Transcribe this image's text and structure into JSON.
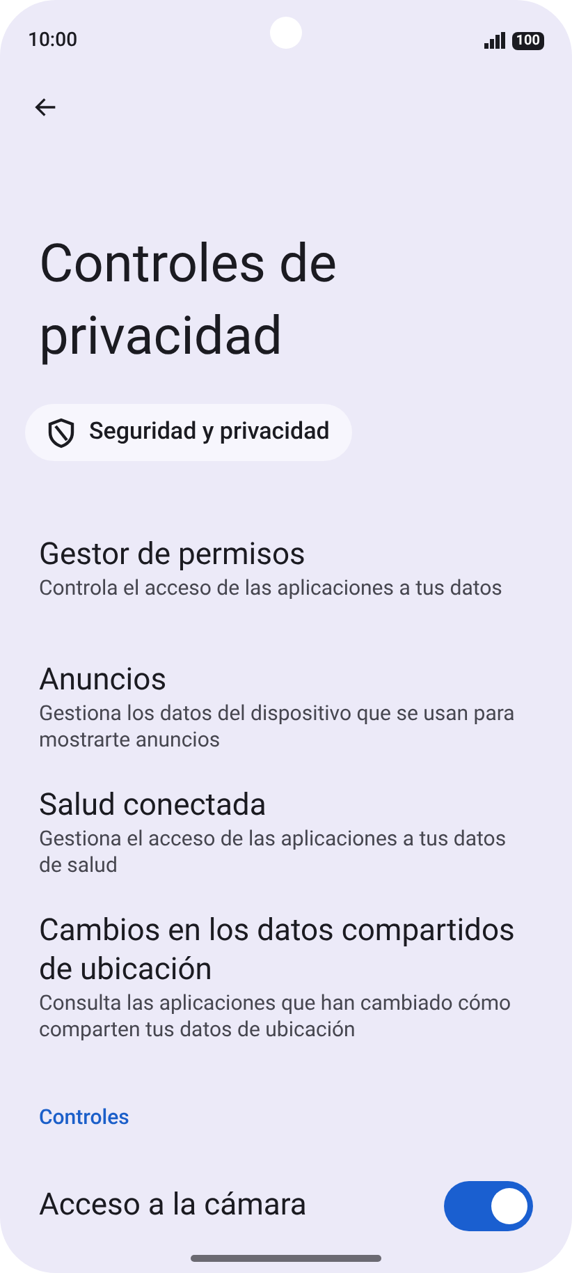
{
  "status_bar": {
    "time": "10:00",
    "battery": "100"
  },
  "title": "Controles de privacidad",
  "chip": {
    "label": "Seguridad y privacidad"
  },
  "items": [
    {
      "title": "Gestor de permisos",
      "subtitle": "Controla el acceso de las aplicaciones a tus datos"
    },
    {
      "title": "Anuncios",
      "subtitle": "Gestiona los datos del dispositivo que se usan para mostrarte anuncios"
    },
    {
      "title": "Salud conectada",
      "subtitle": "Gestiona el acceso de las aplicaciones a tus datos de salud"
    },
    {
      "title": "Cambios en los datos compartidos de ubicación",
      "subtitle": "Consulta las aplicaciones que han cambiado cómo comparten tus datos de ubicación"
    }
  ],
  "section": "Controles",
  "toggles": [
    {
      "title": "Acceso a la cámara",
      "on": true
    }
  ]
}
